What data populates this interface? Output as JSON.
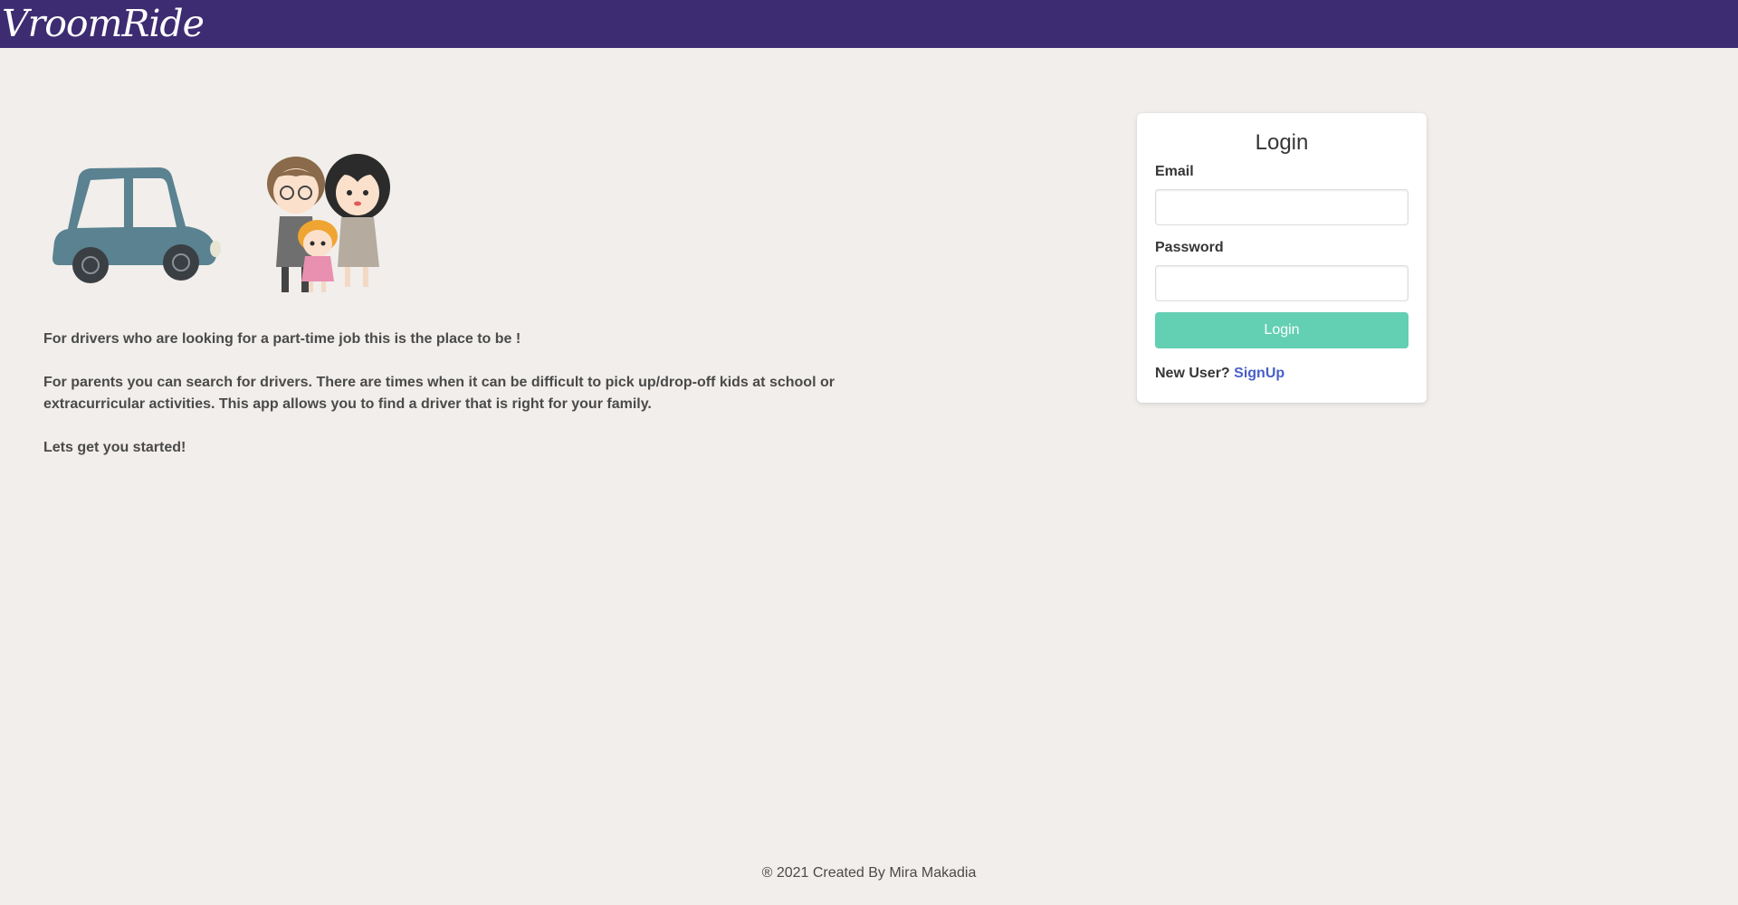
{
  "navbar": {
    "brand": "VroomRide"
  },
  "hero": {
    "images": [
      {
        "name": "car-illustration"
      },
      {
        "name": "family-illustration"
      }
    ],
    "paragraphs": [
      "For drivers who are looking for a part-time job this is the place to be !",
      "For parents you can search for drivers. There are times when it can be difficult to pick up/drop-off kids at school or extracurricular activities. This app allows you to find a driver that is right for your family.",
      "Lets get you started!"
    ]
  },
  "login": {
    "title": "Login",
    "email_label": "Email",
    "email_value": "",
    "password_label": "Password",
    "password_value": "",
    "button_label": "Login",
    "new_user_text": "New User?",
    "signup_label": "SignUp"
  },
  "footer": {
    "text": "® 2021 Created By Mira Makadia"
  },
  "colors": {
    "navbar": "#3d2c72",
    "background": "#f1eeeb",
    "button": "#63cfb3",
    "link": "#485fc7"
  }
}
